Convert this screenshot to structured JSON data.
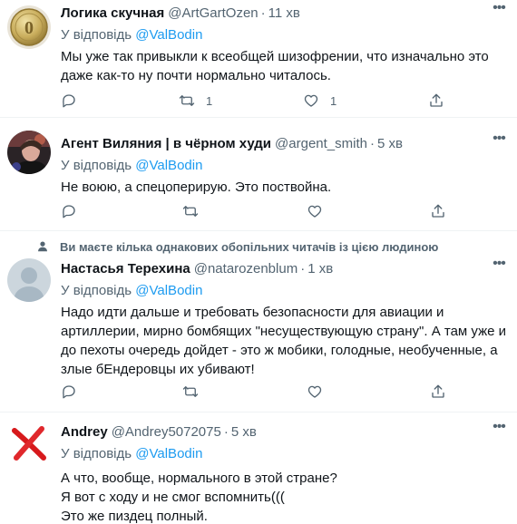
{
  "tweets": [
    {
      "name": "Логика скучная",
      "handle": "@ArtGartOzen",
      "dot": "·",
      "time": "11 хв",
      "reply_prefix": "У відповідь",
      "reply_to": "@ValBodin",
      "text_lines": [
        "Мы уже так привыкли к всеобщей шизофрении, что изначально это",
        "даже как-то ну почти нормально читалось."
      ],
      "retweet_count": "1",
      "like_count": "1"
    },
    {
      "name": "Агент Виляния | в чёрном худи",
      "handle": "@argent_smith",
      "dot": "·",
      "time": "5 хв",
      "reply_prefix": "У відповідь",
      "reply_to": "@ValBodin",
      "text_lines": [
        "Не воюю, а спецоперирую. Это поствойна."
      ],
      "retweet_count": "",
      "like_count": ""
    },
    {
      "social_context": "Ви маєте кілька однакових обопільних читачів із цією людиною",
      "name": "Настасья Терехина",
      "handle": "@natarozenblum",
      "dot": "·",
      "time": "1 хв",
      "reply_prefix": "У відповідь",
      "reply_to": "@ValBodin",
      "text_lines": [
        "Надо идти дальше и требовать безопасности для авиации и",
        "артиллерии, мирно бомбящих \"несуществующую страну\". А там уже и",
        "до пехоты очередь дойдет - это ж мобики, голодные, необученные, а",
        "злые бЕндеровцы их убивают!"
      ],
      "retweet_count": "",
      "like_count": ""
    },
    {
      "name": "Andrey",
      "handle": "@Andrey5072075",
      "dot": "·",
      "time": "5 хв",
      "reply_prefix": "У відповідь",
      "reply_to": "@ValBodin",
      "text_lines": [
        "А что, вообще, нормального в этой стране?",
        "Я вот с ходу и не смог вспомнить(((",
        "Это же пиздец полный."
      ]
    }
  ],
  "colors": {
    "text_primary": "#0f1419",
    "text_secondary": "#536471",
    "accent": "#1d9bf0",
    "divider": "#eff3f4"
  },
  "icons": {
    "more": "more-dots-icon",
    "reply": "reply-bubble-icon",
    "retweet": "retweet-icon",
    "like": "heart-icon",
    "share": "share-icon",
    "social_context": "person-icon"
  }
}
